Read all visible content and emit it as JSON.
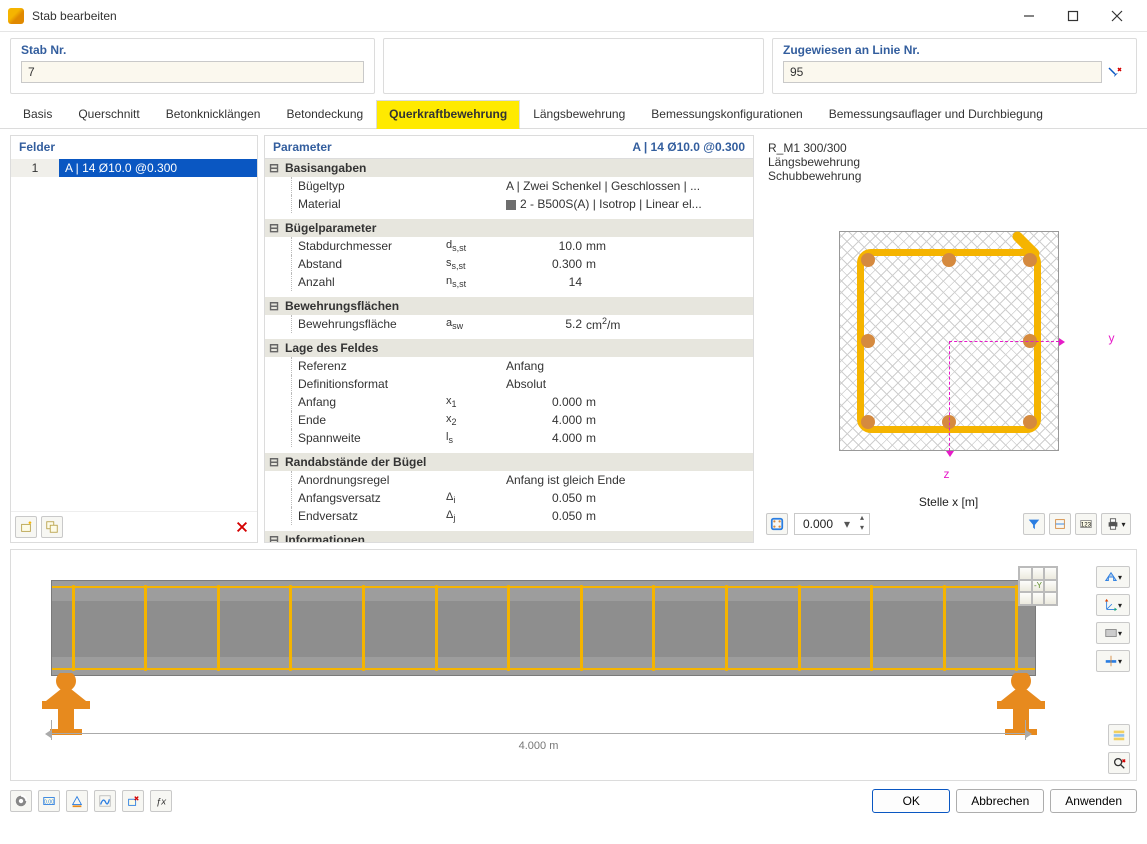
{
  "window": {
    "title": "Stab bearbeiten"
  },
  "top": {
    "stab_label": "Stab Nr.",
    "stab_value": "7",
    "line_label": "Zugewiesen an Linie Nr.",
    "line_value": "95"
  },
  "tabs": [
    "Basis",
    "Querschnitt",
    "Betonknicklängen",
    "Betondeckung",
    "Querkraftbewehrung",
    "Längsbewehrung",
    "Bemessungskonfigurationen",
    "Bemessungsauflager und Durchbiegung"
  ],
  "active_tab_index": 4,
  "fields": {
    "header": "Felder",
    "rows": [
      {
        "num": "1",
        "text": "A | 14 Ø10.0 @0.300"
      }
    ]
  },
  "params": {
    "header": "Parameter",
    "header_right": "A | 14 Ø10.0 @0.300",
    "groups": [
      {
        "title": "Basisangaben",
        "rows": [
          {
            "label": "Bügeltyp",
            "text": "A | Zwei Schenkel | Geschlossen | ..."
          },
          {
            "label": "Material",
            "swatch": true,
            "text": "2 - B500S(A) | Isotrop | Linear el..."
          }
        ]
      },
      {
        "title": "Bügelparameter",
        "rows": [
          {
            "label": "Stabdurchmesser",
            "sym": "d",
            "sub": "s,st",
            "val": "10.0",
            "unit": "mm"
          },
          {
            "label": "Abstand",
            "sym": "s",
            "sub": "s,st",
            "val": "0.300",
            "unit": "m"
          },
          {
            "label": "Anzahl",
            "sym": "n",
            "sub": "s,st",
            "val": "14",
            "unit": ""
          }
        ]
      },
      {
        "title": "Bewehrungsflächen",
        "rows": [
          {
            "label": "Bewehrungsfläche",
            "sym": "a",
            "sub": "sw",
            "val": "5.2",
            "unit_html": "cm²/m"
          }
        ]
      },
      {
        "title": "Lage des Feldes",
        "rows": [
          {
            "label": "Referenz",
            "text": "Anfang"
          },
          {
            "label": "Definitionsformat",
            "text": "Absolut"
          },
          {
            "label": "Anfang",
            "sym": "x",
            "sub": "1",
            "val": "0.000",
            "unit": "m"
          },
          {
            "label": "Ende",
            "sym": "x",
            "sub": "2",
            "val": "4.000",
            "unit": "m"
          },
          {
            "label": "Spannweite",
            "sym": "l",
            "sub": "s",
            "val": "4.000",
            "unit": "m"
          }
        ]
      },
      {
        "title": "Randabstände der Bügel",
        "rows": [
          {
            "label": "Anordnungsregel",
            "text": "Anfang ist gleich Ende"
          },
          {
            "label": "Anfangsversatz",
            "sym": "Δ",
            "sub": "i",
            "val": "0.050",
            "unit": "m"
          },
          {
            "label": "Endversatz",
            "sym": "Δ",
            "sub": "j",
            "val": "0.050",
            "unit": "m"
          }
        ]
      },
      {
        "title": "Informationen",
        "rows": []
      }
    ]
  },
  "preview": {
    "line1": "R_M1 300/300",
    "line2": "Längsbewehrung",
    "line3": "Schubbewehrung",
    "axis_y": "y",
    "axis_z": "z",
    "pos_label": "Stelle x [m]",
    "pos_value": "0.000"
  },
  "beam": {
    "dim_label": "4.000 m"
  },
  "footer": {
    "ok": "OK",
    "cancel": "Abbrechen",
    "apply": "Anwenden"
  }
}
